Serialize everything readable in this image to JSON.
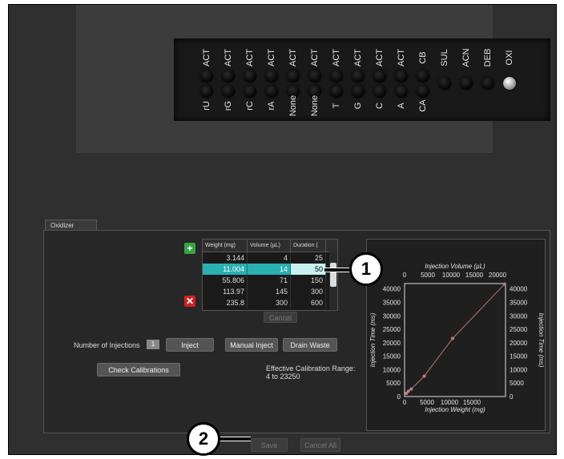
{
  "rack": {
    "columns": [
      {
        "top": "ACT",
        "bottom": "rU",
        "dots": 2
      },
      {
        "top": "ACT",
        "bottom": "rG",
        "dots": 2
      },
      {
        "top": "ACT",
        "bottom": "rC",
        "dots": 2
      },
      {
        "top": "ACT",
        "bottom": "rA",
        "dots": 2
      },
      {
        "top": "ACT",
        "bottom": "None",
        "dots": 2
      },
      {
        "top": "ACT",
        "bottom": "None",
        "dots": 2
      },
      {
        "top": "ACT",
        "bottom": "T",
        "dots": 2
      },
      {
        "top": "ACT",
        "bottom": "G",
        "dots": 2
      },
      {
        "top": "ACT",
        "bottom": "C",
        "dots": 2
      },
      {
        "top": "ACT",
        "bottom": "A",
        "dots": 2
      },
      {
        "top": "CB",
        "bottom": "CA",
        "dots": 2
      },
      {
        "top": "SUL",
        "bottom": "",
        "dots": 1
      },
      {
        "top": "ACN",
        "bottom": "",
        "dots": 1
      },
      {
        "top": "DEB",
        "bottom": "",
        "dots": 1
      },
      {
        "top": "OXI",
        "bottom": "",
        "dots": 1,
        "highlight": true
      }
    ]
  },
  "tab": {
    "label": "Oxidizer"
  },
  "table": {
    "headers": [
      "Weight (mg)",
      "Volume (µL)",
      "Duration ("
    ],
    "rows": [
      [
        "3.144",
        "4",
        "25"
      ],
      [
        "11.004",
        "14",
        "50"
      ],
      [
        "55.806",
        "71",
        "150"
      ],
      [
        "113.97",
        "145",
        "300"
      ],
      [
        "235.8",
        "300",
        "600"
      ]
    ],
    "selected_row": 1
  },
  "buttons": {
    "cancel": "Cancel",
    "inject": "Inject",
    "manual_inject": "Manual Inject",
    "drain_waste": "Drain Waste",
    "check_calibrations": "Check Calibrations",
    "save": "Save",
    "cancel_all": "Cancel All"
  },
  "icons": {
    "add": "plus-icon",
    "remove": "close-icon"
  },
  "injections": {
    "label": "Number of Injections",
    "value": "1"
  },
  "calibration": {
    "label": "Effective Calibration Range:",
    "range": "4 to 23250"
  },
  "chart_data": {
    "type": "scatter",
    "title": "Injection Volume (µL)",
    "xlabel": "Injection Weight (mg)",
    "ylabel": "Injection Time (ms)",
    "ylabel_right": "Injection Time (ms)",
    "x_ticks": [
      "0",
      "5000",
      "10000",
      "15000"
    ],
    "top_ticks": [
      "0",
      "5000",
      "10000",
      "15000",
      "20000"
    ],
    "y_ticks": [
      "0",
      "5000",
      "10000",
      "15000",
      "20000",
      "25000",
      "30000",
      "35000",
      "40000"
    ],
    "xlim": [
      0,
      21000
    ],
    "ylim": [
      0,
      42000
    ],
    "points": [
      {
        "x": 400,
        "y": 1200
      },
      {
        "x": 800,
        "y": 2000
      },
      {
        "x": 1400,
        "y": 2800
      },
      {
        "x": 4100,
        "y": 7600
      },
      {
        "x": 10000,
        "y": 21600
      },
      {
        "x": 20800,
        "y": 41800
      }
    ],
    "line_color": "#c07070",
    "point_color": "#c08080"
  },
  "callouts": {
    "one": "1",
    "two": "2"
  }
}
